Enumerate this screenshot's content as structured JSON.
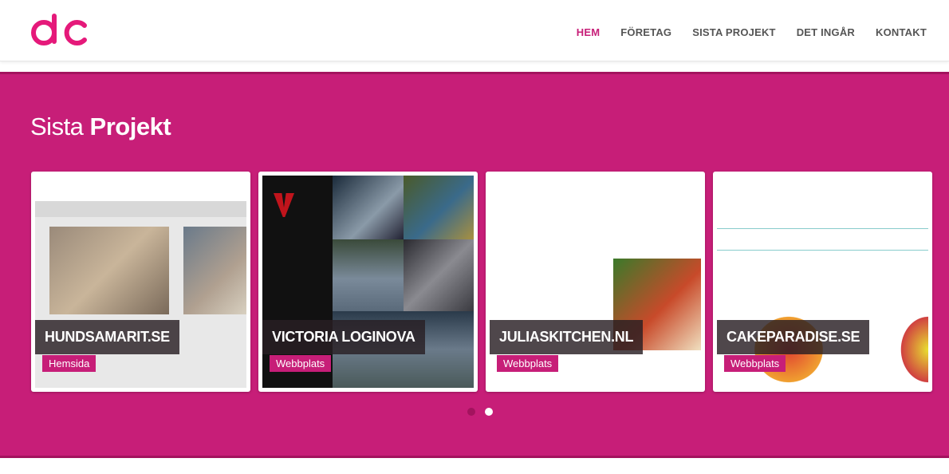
{
  "nav": {
    "items": [
      {
        "label": "HEM",
        "active": true
      },
      {
        "label": "FÖRETAG"
      },
      {
        "label": "SISTA PROJEKT"
      },
      {
        "label": "DET INGÅR"
      },
      {
        "label": "KONTAKT"
      }
    ]
  },
  "section": {
    "title_light": "Sista",
    "title_bold": "Projekt"
  },
  "projects": [
    {
      "name": "HUNDSAMARIT.SE",
      "tag": "Hemsida"
    },
    {
      "name": "VICTORIA LOGINOVA",
      "tag": "Webbplats"
    },
    {
      "name": "JULIASKITCHEN.NL",
      "tag": "Webbplats"
    },
    {
      "name": "CAKEPARADISE.SE",
      "tag": "Webbplats"
    }
  ],
  "colors": {
    "accent": "#c71e78",
    "accent_dark": "#a3135e"
  }
}
